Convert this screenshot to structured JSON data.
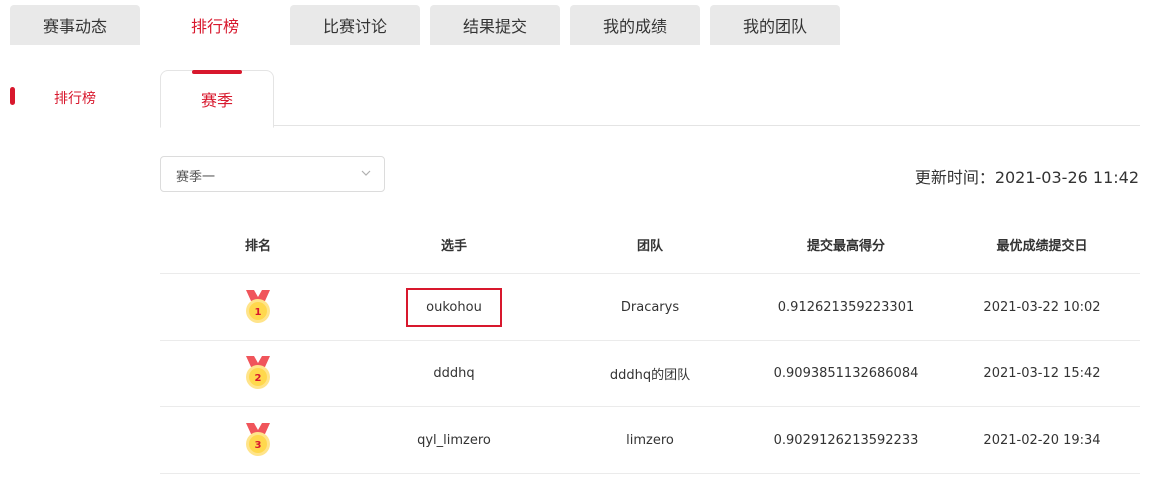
{
  "tabs": [
    {
      "label": "赛事动态",
      "active": false
    },
    {
      "label": "排行榜",
      "active": true
    },
    {
      "label": "比赛讨论",
      "active": false
    },
    {
      "label": "结果提交",
      "active": false
    },
    {
      "label": "我的成绩",
      "active": false
    },
    {
      "label": "我的团队",
      "active": false
    }
  ],
  "sidebar": {
    "item": "排行榜"
  },
  "subtab": {
    "label": "赛季"
  },
  "season_select": {
    "value": "赛季一"
  },
  "updated": {
    "text": "更新时间：2021-03-26 11:42"
  },
  "table": {
    "headers": [
      "排名",
      "选手",
      "团队",
      "提交最高得分",
      "最优成绩提交日"
    ],
    "rows": [
      {
        "rank": "1",
        "player": "oukohou",
        "team": "Dracarys",
        "score": "0.912621359223301",
        "date": "2021-03-22 10:02"
      },
      {
        "rank": "2",
        "player": "dddhq",
        "team": "dddhq的团队",
        "score": "0.9093851132686084",
        "date": "2021-03-12 15:42"
      },
      {
        "rank": "3",
        "player": "qyl_limzero",
        "team": "limzero",
        "score": "0.9029126213592233",
        "date": "2021-02-20 19:34"
      }
    ]
  },
  "colors": {
    "accent": "#d8182d",
    "tab_bg": "#e9e9e9",
    "medal_ribbon": "#f0555b",
    "medal_gold": "#ffd84d"
  }
}
